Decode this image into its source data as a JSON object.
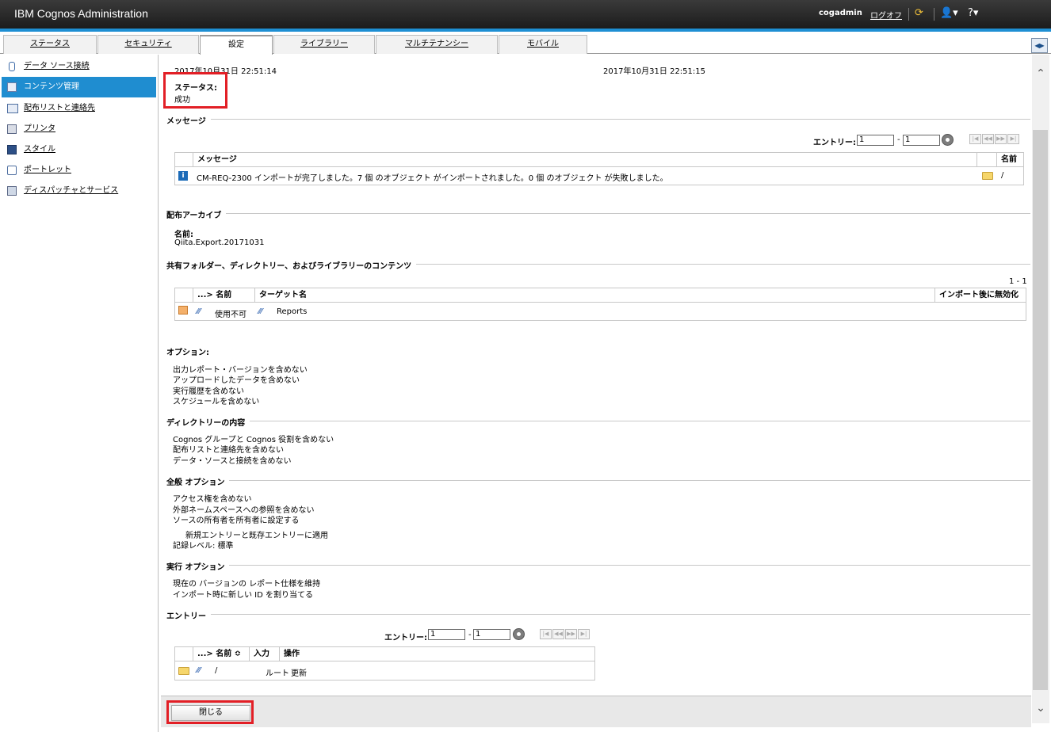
{
  "app": {
    "title": "IBM Cognos Administration",
    "user": "cogadmin",
    "logoff": "ログオフ"
  },
  "tabs": [
    {
      "label": "ステータス"
    },
    {
      "label": "セキュリティ"
    },
    {
      "label": "設定"
    },
    {
      "label": "ライブラリー"
    },
    {
      "label": "マルチテナンシー"
    },
    {
      "label": "モバイル"
    }
  ],
  "sidebar": {
    "items": [
      {
        "label": "データ ソース接続",
        "icon": "database-icon"
      },
      {
        "label": "コンテンツ管理",
        "icon": "content-admin-icon"
      },
      {
        "label": "配布リストと連絡先",
        "icon": "contacts-icon"
      },
      {
        "label": "プリンタ",
        "icon": "printer-icon"
      },
      {
        "label": "スタイル",
        "icon": "style-icon"
      },
      {
        "label": "ポートレット",
        "icon": "portlet-icon"
      },
      {
        "label": "ディスパッチャとサービス",
        "icon": "dispatcher-icon"
      }
    ]
  },
  "run": {
    "start_time": "2017年10月31日 22:51:14",
    "end_time": "2017年10月31日 22:51:15",
    "status_label": "ステータス:",
    "status_value": "成功"
  },
  "messages": {
    "section": "メッセージ",
    "entries_label": "エントリー:",
    "from": "1",
    "to": "1",
    "col_message": "メッセージ",
    "col_name": "名前",
    "rows": [
      {
        "code": "CM-REQ-2300",
        "text": "インポートが完了しました。7 個 のオブジェクト がインポートされました。0 個 のオブジェクト が失敗しました。",
        "name": "/"
      }
    ]
  },
  "archive": {
    "section": "配布アーカイブ",
    "name_label": "名前:",
    "name_value": "Qiita.Export.20171031"
  },
  "shared": {
    "section": "共有フォルダー、ディレクトリー、およびライブラリーのコンテンツ",
    "range": "1 - 1",
    "col_name": "...> 名前",
    "col_target": "ターゲット名",
    "col_disable": "インポート後に無効化",
    "rows": [
      {
        "name": "使用不可",
        "target": "Reports"
      }
    ]
  },
  "options": {
    "section": "オプション:",
    "items": [
      "出力レポート・バージョンを含めない",
      "アップロードしたデータを含めない",
      "実行履歴を含めない",
      "スケジュールを含めない"
    ]
  },
  "directory": {
    "section": "ディレクトリーの内容",
    "items": [
      "Cognos グループと Cognos 役割を含めない",
      "配布リストと連絡先を含めない",
      "データ・ソースと接続を含めない"
    ]
  },
  "general": {
    "section": "全般 オプション",
    "items": [
      "アクセス権を含めない",
      "外部ネームスペースへの参照を含めない",
      "ソースの所有者を所有者に設定する"
    ],
    "sub_item": "新規エントリーと既存エントリーに適用",
    "log_level": "記録レベル: 標準"
  },
  "run_options": {
    "section": "実行 オプション",
    "items": [
      "現在の バージョンの レポート仕様を維持",
      "インポート時に新しい ID を割り当てる"
    ]
  },
  "entries": {
    "section": "エントリー",
    "entries_label": "エントリー:",
    "from": "1",
    "to": "1",
    "col_name": "...> 名前 ≎",
    "col_input": "入力",
    "col_action": "操作",
    "rows": [
      {
        "name": "/",
        "input": "ルート",
        "action": "更新"
      }
    ]
  },
  "footer": {
    "close_label": "閉じる"
  },
  "colors": {
    "accent": "#1e8fd3",
    "highlight": "#e21f26",
    "active_nav": "#1f8dd0"
  }
}
